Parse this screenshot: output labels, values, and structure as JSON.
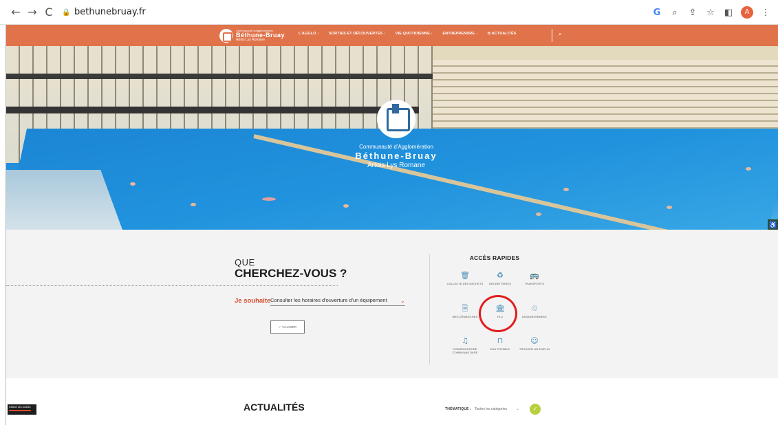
{
  "browser": {
    "url": "bethunebruay.fr",
    "back_icon": "←",
    "forward_icon": "→",
    "reload_icon": "C",
    "lock_icon": "🔒",
    "google_icon": "G",
    "zoom_icon": "⌕",
    "share_icon": "⇪",
    "star_icon": "☆",
    "panel_icon": "◧",
    "avatar_letter": "A",
    "menu_icon": "⋮"
  },
  "site": {
    "logo_line1": "Communauté d'Agglomération",
    "logo_line2": "Béthune-Bruay",
    "logo_line3": "Artois Lys Romane",
    "nav": [
      {
        "label": "L'AGGLO ↓"
      },
      {
        "label": "SORTIES ET DÉCOUVERTES ↓"
      },
      {
        "label": "VIE QUOTIDIENNE ↓"
      },
      {
        "label": "ENTREPRENDRE ↓"
      },
      {
        "label": "ACTUALITÉS"
      }
    ],
    "nav_actualites_icon": "⇆",
    "search_icon": "⌕",
    "accent_color": "#e0734a"
  },
  "hero": {
    "line1": "Communauté d'Agglomération",
    "line2": "Béthune-Bruay",
    "line3": "Artois Lys Romane",
    "accessibility_icon": "♿"
  },
  "search": {
    "que": "QUE",
    "cherchez": "CHERCHEZ-VOUS ?",
    "souhaite_label": "Je souhaite",
    "select_value": "Consulter les horaires d'ouverture d'un équipement",
    "chevron": "⌄",
    "valider": "✓ VALIDER"
  },
  "acces": {
    "title": "ACCÈS RAPIDES",
    "items": [
      {
        "icon": "🗑",
        "label": "COLLECTE DES DÉCHETS"
      },
      {
        "icon": "♻",
        "label": "DÉCHETTERIES"
      },
      {
        "icon": "🚌",
        "label": "TRANSPORTS"
      },
      {
        "icon": "🗎",
        "label": "MES DÉMARCHES"
      },
      {
        "icon": "🏛",
        "label": "PLU"
      },
      {
        "icon": "♲",
        "label": "ASSAINISSEMENT"
      },
      {
        "icon": "♫",
        "label": "CONSERVATOIRE COMMUNAUTAIRE"
      },
      {
        "icon": "⊓",
        "label": "EAU POTABLE"
      },
      {
        "icon": "☺",
        "label": "TROUVER UN EMPLOI"
      }
    ]
  },
  "news": {
    "cookie_label": "Gestion des cookies",
    "title": "ACTUALITÉS",
    "theme_label": "THÉMATIQUE :",
    "theme_value": "Toutes les catégories",
    "theme_chevron": "⌄",
    "ok_icon": "✓"
  }
}
